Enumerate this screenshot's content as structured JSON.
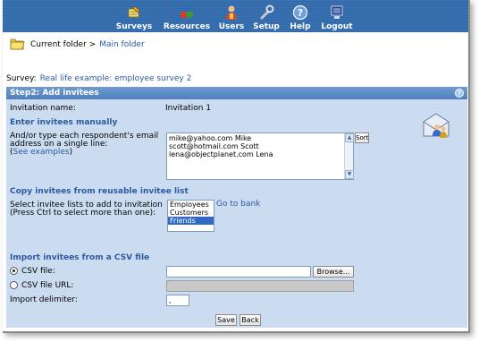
{
  "nav": {
    "items": [
      {
        "label": "Surveys",
        "icon": "pencil-icon"
      },
      {
        "label": "Resources",
        "icon": "shapes-icon"
      },
      {
        "label": "Users",
        "icon": "user-icon"
      },
      {
        "label": "Setup",
        "icon": "wrench-icon"
      },
      {
        "label": "Help",
        "icon": "help-icon"
      },
      {
        "label": "Logout",
        "icon": "logout-icon"
      }
    ]
  },
  "breadcrumb": {
    "current_label": "Current folder >",
    "folder_link": "Main folder"
  },
  "survey": {
    "label": "Survey:",
    "name": "Real life example: employee survey 2"
  },
  "panel": {
    "title": "Step2: Add invitees",
    "help_glyph": "?",
    "invitation_name_label": "Invitation name:",
    "invitation_name_value": "Invitation 1",
    "manual": {
      "heading": "Enter invitees manually",
      "instructions_line1": "And/or type each respondent's email",
      "instructions_line2": "address on a single line:",
      "examples_open": "(",
      "examples_link": "See examples",
      "examples_close": ")",
      "textarea_value": "mike@yahoo.com Mike\nscott@hotmail.com Scott\nlena@objectplanet.com Lena",
      "sort_button": "Sort",
      "scroll_up": "▲",
      "scroll_down": "▼"
    },
    "reusable": {
      "heading": "Copy invitees from reusable invitee list",
      "instructions_line1": "Select invitee lists to add to invitation",
      "instructions_line2": "(Press Ctrl to select more than one):",
      "options": [
        "Employees",
        "Customers",
        "Friends"
      ],
      "selected": "Friends",
      "bank_link": "Go to bank"
    },
    "csv": {
      "heading": "Import invitees from a CSV file",
      "file_label": "CSV file:",
      "file_value": "",
      "browse_button": "Browse...",
      "url_label": "CSV file URL:",
      "url_value": "",
      "delimiter_label": "Import delimiter:",
      "delimiter_value": ","
    },
    "save_button": "Save",
    "back_button": "Back"
  },
  "colors": {
    "nav_background": "#3c74b4",
    "panel_background": "#ccdcf0",
    "panel_header": "#5f8fca",
    "link": "#2b5aa0",
    "list_selected": "#316ac5"
  }
}
